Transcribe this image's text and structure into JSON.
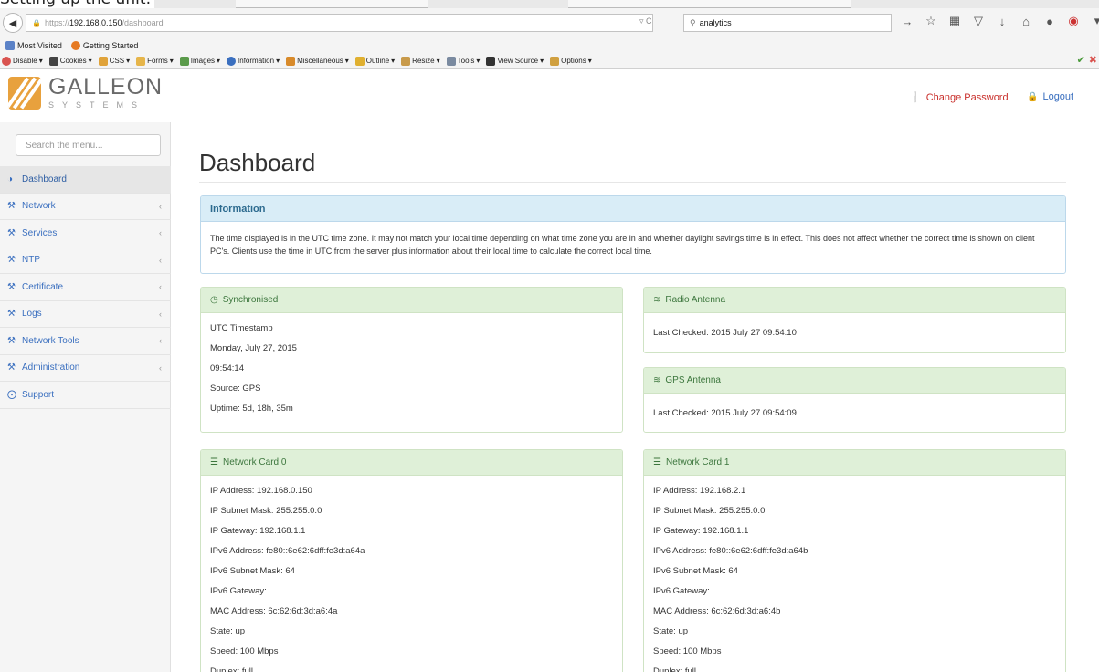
{
  "caption": "Setting up the unit:",
  "browser": {
    "url_scheme": "https://",
    "url_host": "192.168.0.150",
    "url_path": "/dashboard",
    "search_text": "analytics",
    "bookmarks": [
      "Most Visited",
      "Getting Started"
    ],
    "devtools": [
      "Disable",
      "Cookies",
      "CSS",
      "Forms",
      "Images",
      "Information",
      "Miscellaneous",
      "Outline",
      "Resize",
      "Tools",
      "View Source",
      "Options"
    ]
  },
  "header": {
    "logo_name": "GALLEON",
    "logo_sub": "SYSTEMS",
    "change_password": "Change Password",
    "logout": "Logout"
  },
  "sidebar": {
    "search_placeholder": "Search the menu...",
    "items": [
      {
        "label": "Dashboard",
        "icon": "dashboard-icon"
      },
      {
        "label": "Network",
        "icon": "wrench-icon"
      },
      {
        "label": "Services",
        "icon": "wrench-icon"
      },
      {
        "label": "NTP",
        "icon": "wrench-icon"
      },
      {
        "label": "Certificate",
        "icon": "wrench-icon"
      },
      {
        "label": "Logs",
        "icon": "wrench-icon"
      },
      {
        "label": "Network Tools",
        "icon": "wrench-icon"
      },
      {
        "label": "Administration",
        "icon": "wrench-icon"
      },
      {
        "label": "Support",
        "icon": "lifebuoy-icon"
      }
    ]
  },
  "main": {
    "title": "Dashboard",
    "information": {
      "heading": "Information",
      "body": "The time displayed is in the UTC time zone. It may not match your local time depending on what time zone you are in and whether daylight savings time is in effect. This does not affect whether the correct time is shown on client PC's. Clients use the time in UTC from the server plus information about their local time to calculate the correct local time."
    },
    "sync": {
      "heading": "Synchronised",
      "lines": [
        "UTC Timestamp",
        "Monday, July 27, 2015",
        "09:54:14",
        "Source: GPS",
        "Uptime: 5d, 18h, 35m"
      ]
    },
    "radio": {
      "heading": "Radio Antenna",
      "last_checked": "Last Checked: 2015 July 27 09:54:10"
    },
    "gps": {
      "heading": "GPS Antenna",
      "last_checked": "Last Checked: 2015 July 27 09:54:09"
    },
    "nic0": {
      "heading": "Network Card 0",
      "lines": [
        "IP Address: 192.168.0.150",
        "IP Subnet Mask: 255.255.0.0",
        "IP Gateway: 192.168.1.1",
        "IPv6 Address: fe80::6e62:6dff:fe3d:a64a",
        "IPv6 Subnet Mask: 64",
        "IPv6 Gateway:",
        "MAC Address: 6c:62:6d:3d:a6:4a",
        "State: up",
        "Speed: 100 Mbps",
        "Duplex: full"
      ]
    },
    "nic1": {
      "heading": "Network Card 1",
      "lines": [
        "IP Address: 192.168.2.1",
        "IP Subnet Mask: 255.255.0.0",
        "IP Gateway: 192.168.1.1",
        "IPv6 Address: fe80::6e62:6dff:fe3d:a64b",
        "IPv6 Subnet Mask: 64",
        "IPv6 Gateway:",
        "MAC Address: 6c:62:6d:3d:a6:4b",
        "State: up",
        "Speed: 100 Mbps",
        "Duplex: full"
      ]
    }
  },
  "colors": {
    "link": "#3a6fbf",
    "danger": "#c9302c",
    "success_bg": "#dff0d8",
    "info_bg": "#d9edf7"
  }
}
